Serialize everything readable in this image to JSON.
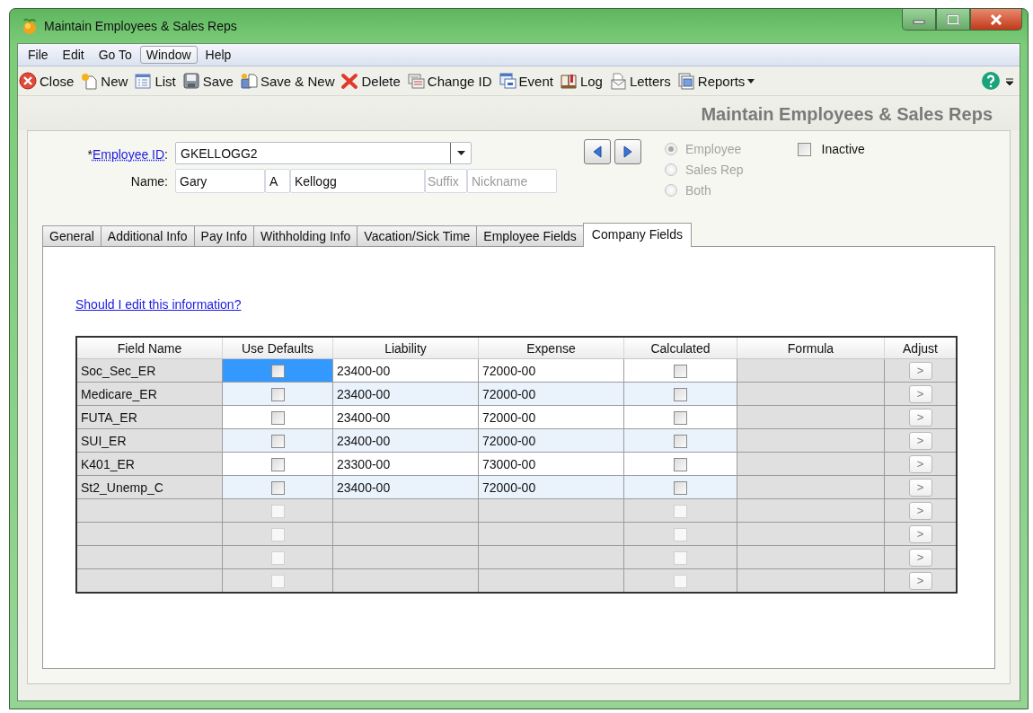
{
  "window": {
    "title": "Maintain Employees & Sales Reps"
  },
  "menu": [
    {
      "label": "File",
      "selected": false
    },
    {
      "label": "Edit",
      "selected": false
    },
    {
      "label": "Go To",
      "selected": false
    },
    {
      "label": "Window",
      "selected": true
    },
    {
      "label": "Help",
      "selected": false
    }
  ],
  "toolbar": [
    {
      "kind": "close",
      "label": "Close"
    },
    {
      "kind": "new",
      "label": "New"
    },
    {
      "kind": "list",
      "label": "List"
    },
    {
      "kind": "save",
      "label": "Save"
    },
    {
      "kind": "savenew",
      "label": "Save & New"
    },
    {
      "kind": "delete",
      "label": "Delete"
    },
    {
      "kind": "changeid",
      "label": "Change ID"
    },
    {
      "kind": "event",
      "label": "Event"
    },
    {
      "kind": "log",
      "label": "Log"
    },
    {
      "kind": "letters",
      "label": "Letters"
    },
    {
      "kind": "reports",
      "label": "Reports",
      "dropdown": true
    }
  ],
  "page_heading": "Maintain Employees & Sales Reps",
  "employee_id": {
    "required_mark": "*",
    "label": "Employee ID",
    "colon": ":",
    "value": "GKELLOGG2"
  },
  "name": {
    "label": "Name:",
    "first": "Gary",
    "middle": "A",
    "last": "Kellogg",
    "suffix_placeholder": "Suffix",
    "nickname_placeholder": "Nickname"
  },
  "type_options": [
    {
      "label": "Employee",
      "selected": true,
      "disabled": true
    },
    {
      "label": "Sales Rep",
      "selected": false,
      "disabled": true
    },
    {
      "label": "Both",
      "selected": false,
      "disabled": true
    }
  ],
  "inactive": {
    "label": "Inactive",
    "checked": false
  },
  "tabs": [
    {
      "label": "General",
      "selected": false
    },
    {
      "label": "Additional Info",
      "selected": false
    },
    {
      "label": "Pay Info",
      "selected": false
    },
    {
      "label": "Withholding Info",
      "selected": false
    },
    {
      "label": "Vacation/Sick Time",
      "selected": false
    },
    {
      "label": "Employee Fields",
      "selected": false
    },
    {
      "label": "Company Fields",
      "selected": true
    }
  ],
  "help_link": "Should I edit this information?",
  "table": {
    "columns": [
      "Field Name",
      "Use Defaults",
      "Liability",
      "Expense",
      "Calculated",
      "Formula",
      "Adjust"
    ],
    "rows": [
      {
        "kind": "filled",
        "selected": true,
        "field_name": "Soc_Sec_ER",
        "use_defaults": false,
        "liability": "23400-00",
        "expense": "72000-00",
        "calculated": false,
        "adjust": ">"
      },
      {
        "kind": "filled",
        "selected": false,
        "field_name": "Medicare_ER",
        "use_defaults": false,
        "liability": "23400-00",
        "expense": "72000-00",
        "calculated": false,
        "adjust": ">"
      },
      {
        "kind": "filled",
        "selected": false,
        "field_name": "FUTA_ER",
        "use_defaults": false,
        "liability": "23400-00",
        "expense": "72000-00",
        "calculated": false,
        "adjust": ">"
      },
      {
        "kind": "filled",
        "selected": false,
        "field_name": "SUI_ER",
        "use_defaults": false,
        "liability": "23400-00",
        "expense": "72000-00",
        "calculated": false,
        "adjust": ">"
      },
      {
        "kind": "filled",
        "selected": false,
        "field_name": "K401_ER",
        "use_defaults": false,
        "liability": "23300-00",
        "expense": "73000-00",
        "calculated": false,
        "adjust": ">"
      },
      {
        "kind": "filled",
        "selected": false,
        "field_name": "St2_Unemp_C",
        "use_defaults": false,
        "liability": "23400-00",
        "expense": "72000-00",
        "calculated": false,
        "adjust": ">"
      },
      {
        "kind": "blank",
        "selected": false,
        "use_defaults": false,
        "calculated": false,
        "adjust": ">"
      },
      {
        "kind": "blank",
        "selected": false,
        "use_defaults": false,
        "calculated": false,
        "adjust": ">"
      },
      {
        "kind": "blank",
        "selected": false,
        "use_defaults": false,
        "calculated": false,
        "adjust": ">"
      },
      {
        "kind": "blank",
        "selected": false,
        "use_defaults": false,
        "calculated": false,
        "adjust": ">"
      }
    ]
  }
}
